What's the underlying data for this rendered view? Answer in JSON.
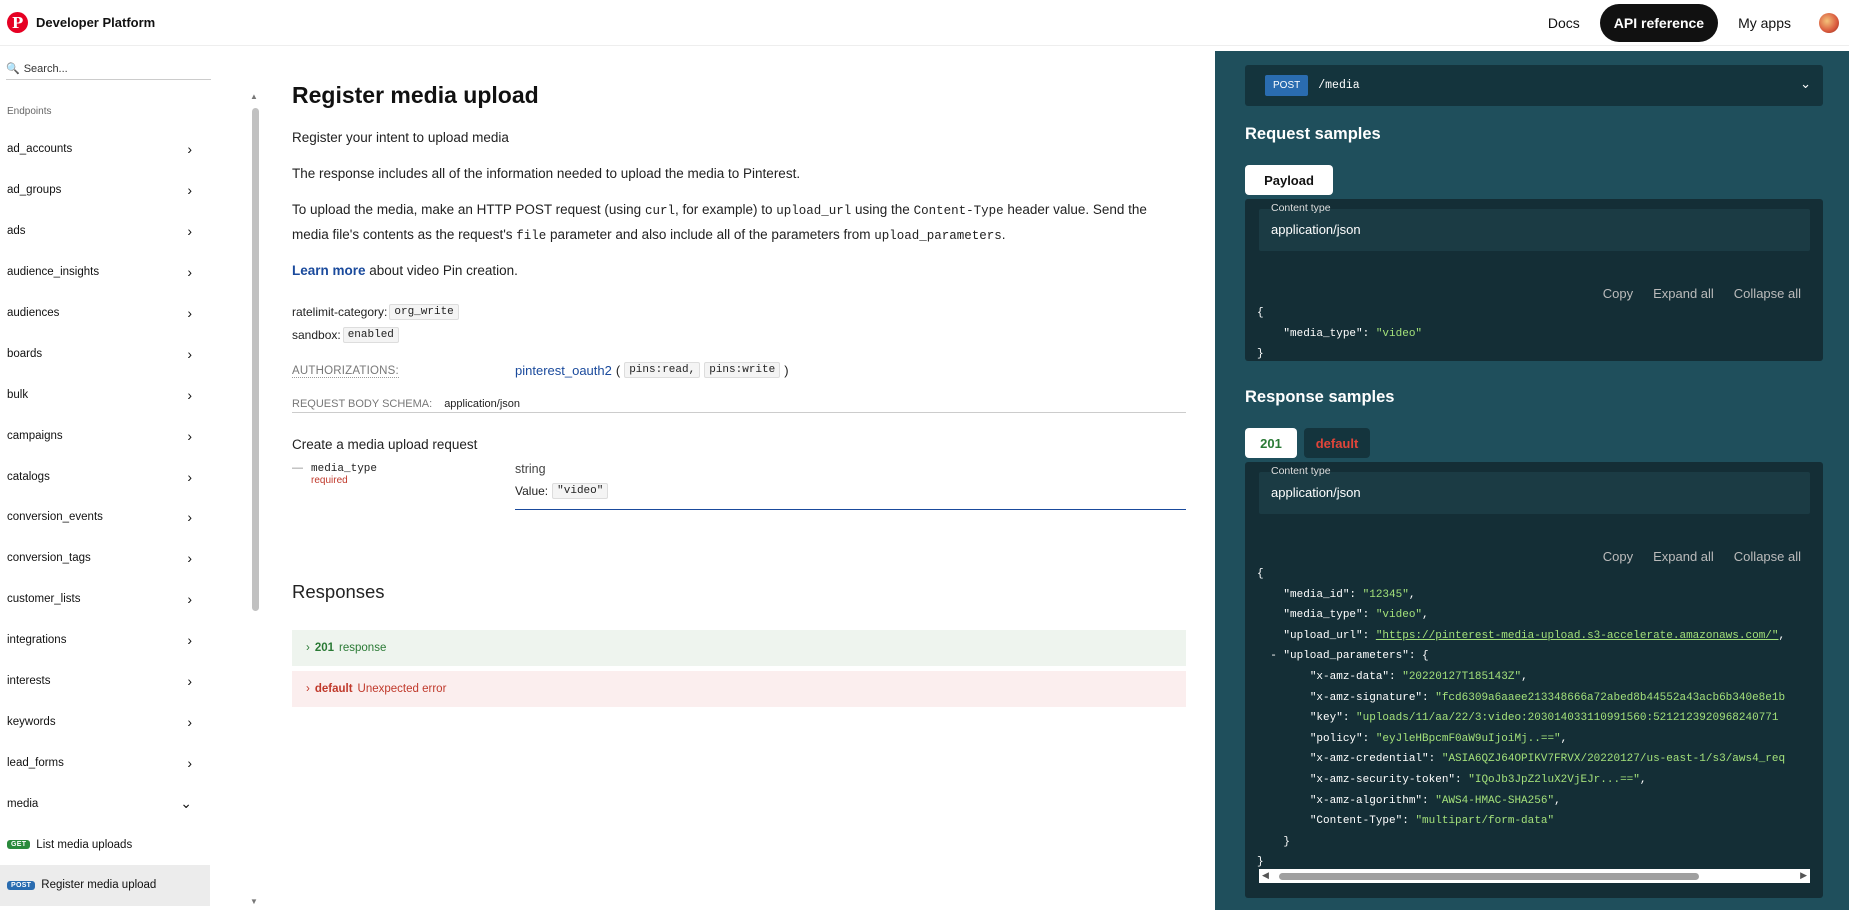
{
  "header": {
    "brand": "Developer Platform",
    "nav": [
      "Docs",
      "API reference",
      "My apps"
    ],
    "active_nav": "API reference"
  },
  "sidebar": {
    "search_placeholder": "Search...",
    "section_label": "Endpoints",
    "items": [
      "ad_accounts",
      "ad_groups",
      "ads",
      "audience_insights",
      "audiences",
      "boards",
      "bulk",
      "campaigns",
      "catalogs",
      "conversion_events",
      "conversion_tags",
      "customer_lists",
      "integrations",
      "interests",
      "keywords",
      "lead_forms",
      "media"
    ],
    "expanded_item": "media",
    "sub_items": [
      {
        "method": "GET",
        "label": "List media uploads"
      },
      {
        "method": "POST",
        "label": "Register media upload",
        "active": true
      }
    ]
  },
  "main": {
    "title": "Register media upload",
    "intro": "Register your intent to upload media",
    "para1": "The response includes all of the information needed to upload the media to Pinterest.",
    "para2_a": "To upload the media, make an HTTP POST request (using ",
    "para2_curl": "curl",
    "para2_b": ", for example) to ",
    "para2_upload_url": "upload_url",
    "para2_c": " using the ",
    "para2_ct": "Content-Type",
    "para2_d": " header value. Send the",
    "para2_e": "media file's contents as the request's ",
    "para2_file": "file",
    "para2_f": " parameter and also include all of the parameters from ",
    "para2_params": "upload_parameters",
    "para2_g": ".",
    "learn_more": "Learn more",
    "learn_more_rest": " about video Pin creation.",
    "ratelimit_label": "ratelimit-category:",
    "ratelimit_value": "org_write",
    "sandbox_label": "sandbox:",
    "sandbox_value": "enabled",
    "auth_label": "AUTHORIZATIONS:",
    "auth_name": "pinterest_oauth2",
    "auth_open": " (",
    "auth_scope1": "pins:read,",
    "auth_scope2": "pins:write",
    "auth_close": ")",
    "body_schema_label": "REQUEST BODY SCHEMA:",
    "body_schema_value": "application/json",
    "create_text": "Create a media upload request",
    "field_name": "media_type",
    "field_required": "required",
    "field_type": "string",
    "field_value_label": "Value:",
    "field_value": "\"video\"",
    "responses_title": "Responses",
    "responses": [
      {
        "code": "201",
        "text": "response"
      },
      {
        "code": "default",
        "text": "Unexpected error"
      }
    ]
  },
  "panel": {
    "method": "POST",
    "path": "/media",
    "request_title": "Request samples",
    "request_tab": "Payload",
    "content_type_label": "Content type",
    "content_type_value": "application/json",
    "tools": [
      "Copy",
      "Expand all",
      "Collapse all"
    ],
    "response_title": "Response samples",
    "response_tabs": [
      "201",
      "default"
    ]
  },
  "request_sample": {
    "open": "{",
    "line": [
      "\"media_type\"",
      ": ",
      "\"video\""
    ],
    "close": "}"
  },
  "response_sample": {
    "lines": [
      {
        "indent": 0,
        "k": "{",
        "s": ""
      },
      {
        "indent": 1,
        "k": "\"media_id\": ",
        "s": "\"12345\"",
        "tail": ","
      },
      {
        "indent": 1,
        "k": "\"media_type\": ",
        "s": "\"video\"",
        "tail": ","
      },
      {
        "indent": 1,
        "k": "\"upload_url\": ",
        "u": "\"https://pinterest-media-upload.s3-accelerate.amazonaws.com/\"",
        "tail": ","
      },
      {
        "indent": 1,
        "k": "\"upload_parameters\": {",
        "s": "",
        "dash": "- "
      },
      {
        "indent": 2,
        "k": "\"x-amz-data\": ",
        "s": "\"20220127T185143Z\"",
        "tail": ","
      },
      {
        "indent": 2,
        "k": "\"x-amz-signature\": ",
        "s": "\"fcd6309a6aaee213348666a72abed8b44552a43acb6b340e8e1b",
        "tail": ""
      },
      {
        "indent": 2,
        "k": "\"key\": ",
        "s": "\"uploads/11/aa/22/3:video:203014033110991560:5212123920968240771",
        "tail": ""
      },
      {
        "indent": 2,
        "k": "\"policy\": ",
        "s": "\"eyJleHBpcmF0aW9uIjoiMj..==\"",
        "tail": ","
      },
      {
        "indent": 2,
        "k": "\"x-amz-credential\": ",
        "s": "\"ASIA6QZJ64OPIKV7FRVX/20220127/us-east-1/s3/aws4_req",
        "tail": ""
      },
      {
        "indent": 2,
        "k": "\"x-amz-security-token\": ",
        "s": "\"IQoJb3JpZ2luX2VjEJr...==\"",
        "tail": ","
      },
      {
        "indent": 2,
        "k": "\"x-amz-algorithm\": ",
        "s": "\"AWS4-HMAC-SHA256\"",
        "tail": ","
      },
      {
        "indent": 2,
        "k": "\"Content-Type\": ",
        "s": "\"multipart/form-data\"",
        "tail": ""
      },
      {
        "indent": 1,
        "k": "}",
        "s": ""
      },
      {
        "indent": 0,
        "k": "}",
        "s": ""
      }
    ]
  },
  "colors": {
    "panel_bg": "#1f4f5c",
    "accent_blue": "#1a4a9c",
    "post_badge": "#2a6cb0",
    "get_badge": "#2a8a3c",
    "success_green": "#2a7a35",
    "error_red": "#c0392b",
    "brand_red": "#e60023"
  }
}
